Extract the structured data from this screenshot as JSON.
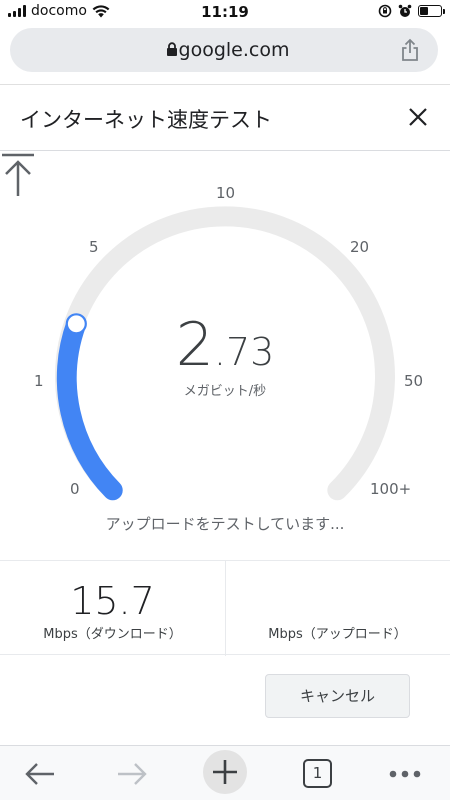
{
  "status_bar": {
    "carrier": "docomo",
    "time": "11:19"
  },
  "browser": {
    "url": "google.com"
  },
  "header": {
    "title": "インターネット速度テスト"
  },
  "gauge": {
    "ticks": [
      "0",
      "1",
      "5",
      "10",
      "20",
      "50",
      "100+"
    ],
    "speed_integer": "2",
    "speed_decimal": ".73",
    "unit": "メガビット/秒",
    "status_message": "アップロードをテストしています...",
    "progress_color": "#4285f4",
    "track_color": "#ebebeb"
  },
  "results": {
    "download_value": "15.7",
    "download_label": "Mbps（ダウンロード）",
    "upload_label": "Mbps（アップロード）"
  },
  "actions": {
    "cancel_label": "キャンセル"
  },
  "toolbar": {
    "tab_count": "1"
  }
}
